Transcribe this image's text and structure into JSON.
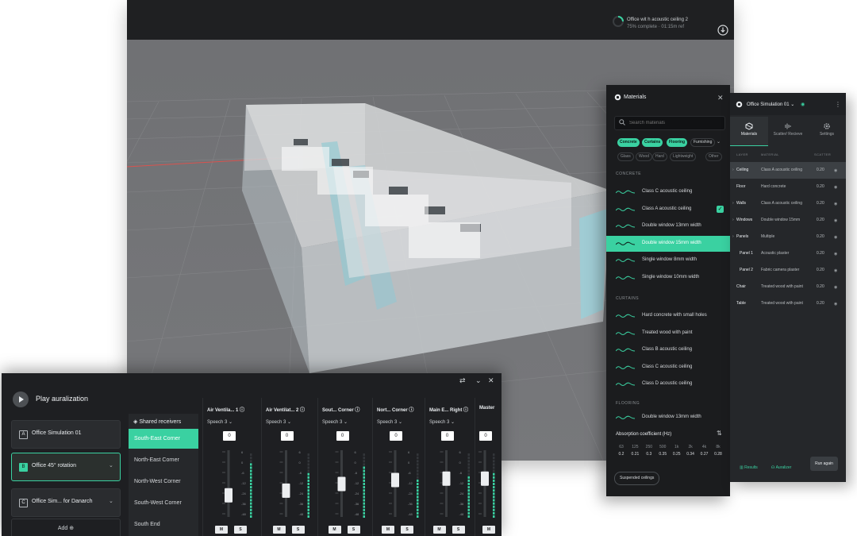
{
  "viewport": {
    "status_title": "Office wit h acoustic ceiling 2",
    "status_sub": "75% complete · 01:15m ref",
    "icons": {
      "status": "running-spinner-icon",
      "download": "download-icon"
    }
  },
  "materials": {
    "title": "Materials",
    "search_placeholder": "Search materials",
    "chips_on": [
      "Concrete",
      "Curtains",
      "Flooring"
    ],
    "chip_more": "Furnishing",
    "chips_off": [
      "Glass",
      "Wood",
      "Hard",
      "Lightweight",
      "Other"
    ],
    "sections": {
      "concrete": "CONCRETE",
      "curtains": "CURTAINS",
      "flooring": "FLOORING"
    },
    "concrete_items": [
      "Class C acoustic ceiling",
      "Class A acoustic ceiling",
      "Double window 13mm width",
      "Double window 15mm width",
      "Single window 8mm width",
      "Single window 10mm width"
    ],
    "curtain_items": [
      "Hard concrete with small holes",
      "Treated wood with paint",
      "Class B acoustic ceiling",
      "Class C acoustic ceiling",
      "Class D acoustic ceiling"
    ],
    "flooring_items": [
      "Double window 13mm width"
    ],
    "selected_index": 3,
    "checked_index": 1,
    "absorption": {
      "title": "Absorption coefficient (Hz)",
      "freqs": [
        "63",
        "125",
        "250",
        "500",
        "1k",
        "2k",
        "4k",
        "8k"
      ],
      "values": [
        "0.2",
        "0.21",
        "0.3",
        "0.35",
        "0.25",
        "0.34",
        "0.27",
        "0.28"
      ]
    },
    "chip_bottom": "Suspended ceilings",
    "accent": "#3ad1a1"
  },
  "simulation": {
    "title": "Office Simulation 01",
    "tabs": [
      "Materials",
      "Scatter/ Recieve",
      "Settings"
    ],
    "headers": {
      "layer": "LAYER",
      "material": "MATERIAL",
      "scatter": "SCATTER"
    },
    "rows": [
      {
        "layer": "Ceiling",
        "material": "Class A acoustic ceiling",
        "scatter": "0.20"
      },
      {
        "layer": "Floor",
        "material": "Hard concrete",
        "scatter": "0.20"
      },
      {
        "layer": "Walls",
        "material": "Class A acoustic ceiling",
        "scatter": "0.20"
      },
      {
        "layer": "Windows",
        "material": "Double window 15mm",
        "scatter": "0.20"
      },
      {
        "layer": "Panels",
        "material": "Multiple",
        "scatter": "0.20"
      },
      {
        "layer": "Panel 1",
        "material": "Acoustic plaster",
        "scatter": "0.20"
      },
      {
        "layer": "Panel 2",
        "material": "Fabric camera plaster",
        "scatter": "0.20"
      },
      {
        "layer": "Chair",
        "material": "Treated wood with paint",
        "scatter": "0.20"
      },
      {
        "layer": "Table",
        "material": "Treated wood with paint",
        "scatter": "0.20"
      }
    ],
    "footer": {
      "results": "Results",
      "auralizer": "Auralizer",
      "run": "Run again"
    }
  },
  "auralization": {
    "title": "Play auralization",
    "simulations": [
      {
        "badge": "A",
        "name": "Office Simulation 01"
      },
      {
        "badge": "B",
        "name": "Office 45° rotation"
      },
      {
        "badge": "C",
        "name": "Office Sim... for Danarch"
      }
    ],
    "add_label": "Add",
    "receivers_header": "Shared receivers",
    "receivers": [
      "South-East Corner",
      "North-East Corner",
      "North-West Corner",
      "South-West Corner",
      "South End"
    ],
    "strips": [
      {
        "title": "Air Ventila... 1",
        "preset": "Speech 3",
        "gain": "0",
        "fader": 0.55,
        "meter": 0.85
      },
      {
        "title": "Air Ventilat... 2",
        "preset": "Speech 3",
        "gain": "0",
        "fader": 0.62,
        "meter": 0.7
      },
      {
        "title": "Sout... Corner",
        "preset": "Speech 3",
        "gain": "0",
        "fader": 0.72,
        "meter": 0.78
      },
      {
        "title": "Nort... Corner",
        "preset": "Speech 3",
        "gain": "0",
        "fader": 0.78,
        "meter": 0.6
      },
      {
        "title": "Main E... Right",
        "preset": "Speech 3",
        "gain": "0",
        "fader": 0.8,
        "meter": 0.65
      },
      {
        "title": "Master",
        "preset": "",
        "gain": "0",
        "fader": 0.8,
        "meter": 0.7
      }
    ],
    "scale": [
      "6",
      "0",
      "-6",
      "-12",
      "-24",
      "-36",
      "-48"
    ],
    "mute": "M",
    "solo": "S"
  }
}
